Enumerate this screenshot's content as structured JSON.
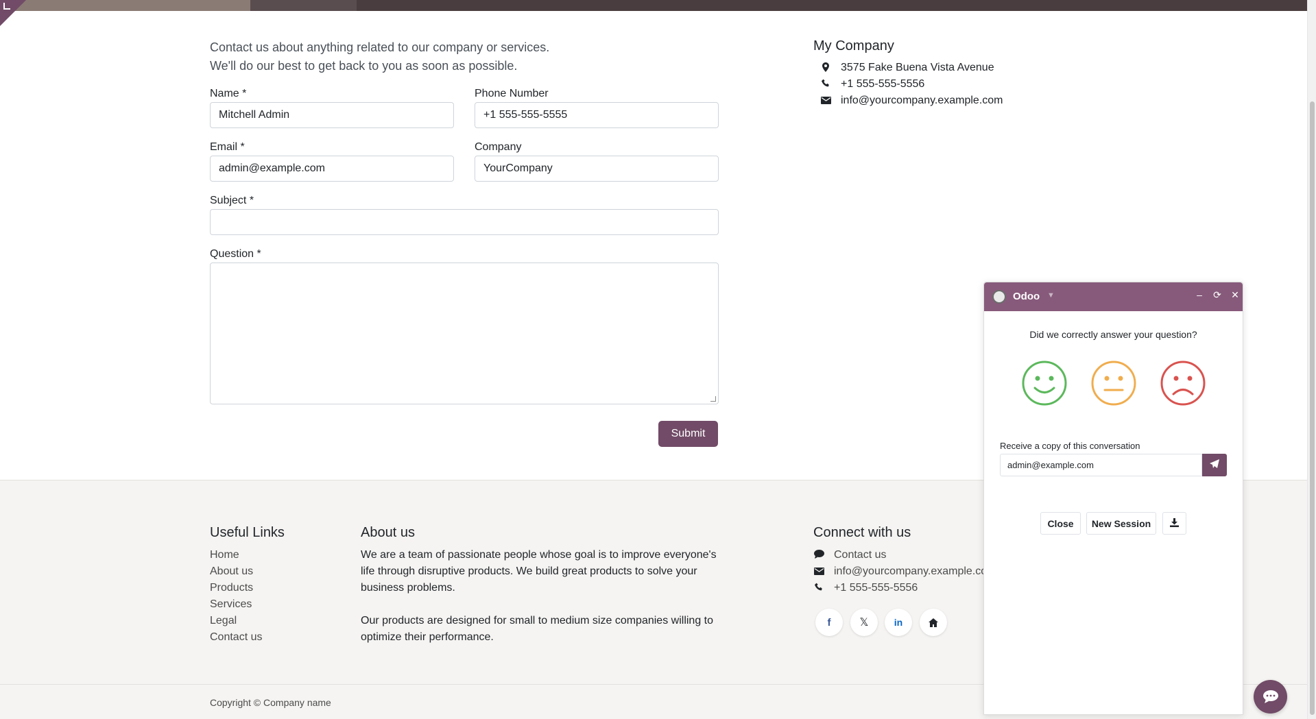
{
  "contact_form": {
    "intro_line1": "Contact us about anything related to our company or services.",
    "intro_line2": "We'll do our best to get back to you as soon as possible.",
    "name_label": "Name *",
    "name_value": "Mitchell Admin",
    "phone_label": "Phone Number",
    "phone_value": "+1 555-555-5555",
    "email_label": "Email *",
    "email_value": "admin@example.com",
    "company_label": "Company",
    "company_value": "YourCompany",
    "subject_label": "Subject *",
    "subject_value": "",
    "question_label": "Question *",
    "question_value": "",
    "submit_label": "Submit"
  },
  "company_info": {
    "title": "My Company",
    "address": "3575 Fake Buena Vista Avenue",
    "phone": "+1 555-555-5556",
    "email": "info@yourcompany.example.com"
  },
  "footer": {
    "useful_links_title": "Useful Links",
    "links": [
      "Home",
      "About us",
      "Products",
      "Services",
      "Legal",
      "Contact us"
    ],
    "about_title": "About us",
    "about_p1": "We are a team of passionate people whose goal is to improve everyone's life through disruptive products. We build great products to solve your business problems.",
    "about_p2": "Our products are designed for small to medium size companies willing to optimize their performance.",
    "connect_title": "Connect with us",
    "connect_contact": "Contact us",
    "connect_email": "info@yourcompany.example.com",
    "connect_phone": "+1 555-555-5556",
    "social_icons": [
      "facebook-icon",
      "x-twitter-icon",
      "linkedin-icon",
      "home-icon"
    ],
    "copyright": "Copyright © Company name"
  },
  "chat": {
    "title": "Odoo",
    "question": "Did we correctly answer your question?",
    "rating_icons": [
      "happy-face-icon",
      "neutral-face-icon",
      "sad-face-icon"
    ],
    "copy_label": "Receive a copy of this conversation",
    "copy_email": "admin@example.com",
    "close_label": "Close",
    "new_session_label": "New Session",
    "colors": {
      "header": "#875a7b",
      "accent": "#714b67",
      "happy": "#5cb85c",
      "neutral": "#f0ad4e",
      "sad": "#d9534f"
    }
  }
}
